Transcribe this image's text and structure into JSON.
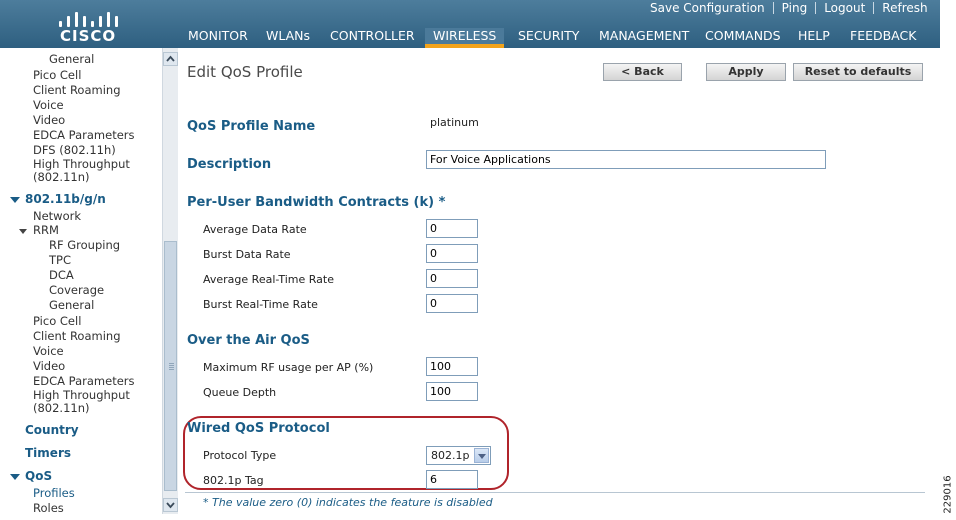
{
  "header": {
    "logo_text": "CISCO",
    "utility_links": [
      "Save Configuration",
      "Ping",
      "Logout",
      "Refresh"
    ],
    "nav_items": [
      "MONITOR",
      "WLANs",
      "CONTROLLER",
      "WIRELESS",
      "SECURITY",
      "MANAGEMENT",
      "COMMANDS",
      "HELP",
      "FEEDBACK"
    ],
    "active_nav": "WIRELESS"
  },
  "sidebar": {
    "items": [
      "General",
      "Pico Cell",
      "Client Roaming",
      "Voice",
      "Video",
      "EDCA Parameters",
      "DFS (802.11h)",
      "High Throughput",
      "(802.11n)",
      "802.11b/g/n",
      "Network",
      "RRM",
      "RF Grouping",
      "TPC",
      "DCA",
      "Coverage",
      "General",
      "Pico Cell",
      "Client Roaming",
      "Voice",
      "Video",
      "EDCA Parameters",
      "High Throughput",
      "(802.11n)",
      "Country",
      "Timers",
      "QoS",
      "Profiles",
      "Roles"
    ]
  },
  "page": {
    "title": "Edit QoS Profile",
    "buttons": {
      "back": "< Back",
      "apply": "Apply",
      "reset": "Reset to defaults"
    },
    "profile_name_label": "QoS Profile Name",
    "profile_name_value": "platinum",
    "description_label": "Description",
    "description_value": "For Voice Applications",
    "bandwidth_section": "Per-User Bandwidth Contracts (k) *",
    "bandwidth_fields": [
      {
        "label": "Average Data Rate",
        "value": "0"
      },
      {
        "label": "Burst Data Rate",
        "value": "0"
      },
      {
        "label": "Average Real-Time Rate",
        "value": "0"
      },
      {
        "label": "Burst Real-Time Rate",
        "value": "0"
      }
    ],
    "air_section": "Over the Air QoS",
    "air_fields": [
      {
        "label": "Maximum RF usage per AP (%)",
        "value": "100"
      },
      {
        "label": "Queue Depth",
        "value": "100"
      }
    ],
    "wired_section": "Wired QoS Protocol",
    "protocol_label": "Protocol Type",
    "protocol_value": "802.1p",
    "tag_label": "802.1p Tag",
    "tag_value": "6",
    "footnote": "* The value zero (0) indicates the feature is disabled",
    "figure_id": "229016"
  },
  "colors": {
    "header_bg": "#3a6b8c",
    "accent": "#f2a31b",
    "section_blue": "#1a5c86",
    "highlight_red": "#b0242b"
  }
}
